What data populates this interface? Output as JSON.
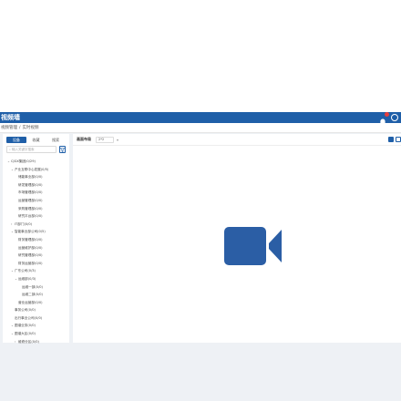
{
  "header": {
    "title": "视频墙",
    "bg_color": "#1f5fa8",
    "icons": [
      "bell-icon",
      "gear-icon"
    ]
  },
  "breadcrumb": {
    "items": [
      "视频管理",
      "实时视频"
    ]
  },
  "sidebar": {
    "tabs": [
      "设备",
      "收藏",
      "搜索"
    ],
    "active_tab": 0,
    "search_placeholder": "输入关键字搜索",
    "tree": [
      {
        "label": "CJGX集团(0/29)",
        "expanded": true,
        "level": 0
      },
      {
        "label": "产业互联中心发展(0/5)",
        "expanded": true,
        "level": 1
      },
      {
        "label": "储能事业部(0/0)",
        "level": 2
      },
      {
        "label": "研发管理部(0/0)",
        "level": 2
      },
      {
        "label": "市场管理部(0/0)",
        "level": 2
      },
      {
        "label": "运营管理部(0/0)",
        "level": 2
      },
      {
        "label": "采购管理部(0/0)",
        "level": 2
      },
      {
        "label": "研究平台部(0/0)",
        "level": 2
      },
      {
        "label": "IT部门(0/0)",
        "expanded": false,
        "level": 1
      },
      {
        "label": "智能事业部公司(0/5)",
        "expanded": true,
        "level": 1
      },
      {
        "label": "财务管理部(0/0)",
        "level": 2
      },
      {
        "label": "运营维护部(0/0)",
        "level": 2
      },
      {
        "label": "研究管理部(0/0)",
        "level": 2
      },
      {
        "label": "财务运营部(0/0)",
        "level": 2
      },
      {
        "label": "广东公司(0/3)",
        "expanded": true,
        "level": 1
      },
      {
        "label": "运维部(0/3)",
        "expanded": true,
        "level": 2
      },
      {
        "label": "运维一部(0/0)",
        "level": 3
      },
      {
        "label": "运维二部(0/0)",
        "level": 3
      },
      {
        "label": "营业运营部(0/0)",
        "level": 2
      },
      {
        "label": "事务公司(0/0)",
        "level": 1
      },
      {
        "label": "出行事业公司(0/0)",
        "level": 1
      },
      {
        "label": "图谱业务(0/0)",
        "expanded": true,
        "level": 1
      },
      {
        "label": "图谱大区(0/0)",
        "expanded": true,
        "level": 1
      },
      {
        "label": "维修分区(0/0)",
        "expanded": false,
        "level": 2
      }
    ]
  },
  "toolbar": {
    "label": "画面布局",
    "layout_value": "2*2"
  },
  "main": {
    "placeholder_icon": "video-camera-icon",
    "icon_color": "#2b5ea5"
  }
}
